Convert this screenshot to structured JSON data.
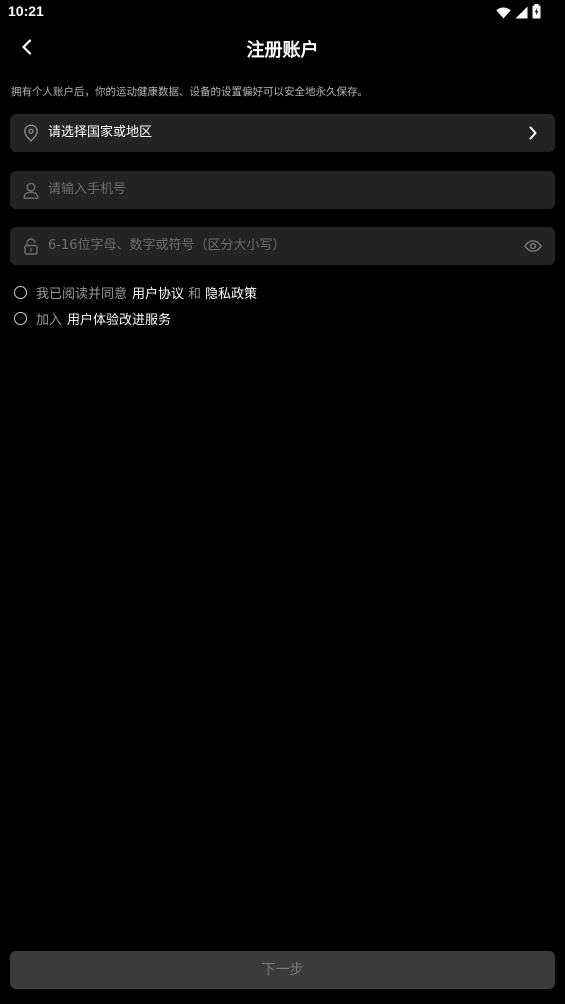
{
  "status_bar": {
    "time": "10:21",
    "icons": [
      "wifi-icon",
      "cellular-signal-icon",
      "battery-icon"
    ]
  },
  "header": {
    "title": "注册账户",
    "back_icon": "chevron-left-icon"
  },
  "subtitle": "拥有个人账户后，你的运动健康数据、设备的设置偏好可以安全地永久保存。",
  "form": {
    "country": {
      "icon": "location-pin-icon",
      "label": "请选择国家或地区",
      "right_icon": "chevron-right-icon"
    },
    "phone": {
      "icon": "user-icon",
      "placeholder": "请输入手机号"
    },
    "password": {
      "icon": "lock-icon",
      "placeholder": "6-16位字母、数字或符号（区分大小写）",
      "right_icon": "eye-icon"
    }
  },
  "agreements": {
    "agree_prefix": "我已阅读并同意",
    "user_agreement": "用户协议",
    "and": "和",
    "privacy_policy": "隐私政策",
    "join_prefix": "加入",
    "improve_program": "用户体验改进服务"
  },
  "footer": {
    "next_label": "下一步"
  },
  "colors": {
    "background": "#000000",
    "field_bg": "#232323",
    "placeholder": "#6e6e6e",
    "button_bg": "#3b3b3b",
    "button_text": "#7a7a7a"
  }
}
